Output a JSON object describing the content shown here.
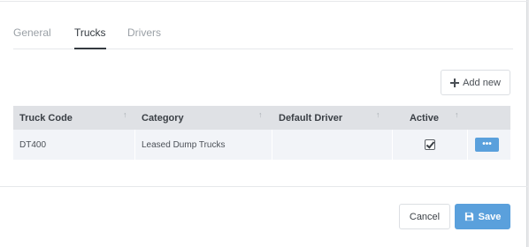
{
  "tabs": [
    {
      "label": "General",
      "active": false
    },
    {
      "label": "Trucks",
      "active": true
    },
    {
      "label": "Drivers",
      "active": false
    }
  ],
  "toolbar": {
    "add_label": "Add new"
  },
  "table": {
    "columns": [
      "Truck Code",
      "Category",
      "Default Driver",
      "Active"
    ],
    "rows": [
      {
        "truck_code": "DT400",
        "category": "Leased Dump Trucks",
        "default_driver": "",
        "active": true
      }
    ]
  },
  "footer": {
    "cancel_label": "Cancel",
    "save_label": "Save"
  },
  "colors": {
    "accent": "#5aa0dc",
    "header_bg": "#dfe1e5",
    "row_bg": "#f2f4f8"
  },
  "icons": {
    "add": "plus-icon",
    "sort": "sort-icon",
    "more": "ellipsis-icon",
    "save": "floppy-disk-icon"
  }
}
